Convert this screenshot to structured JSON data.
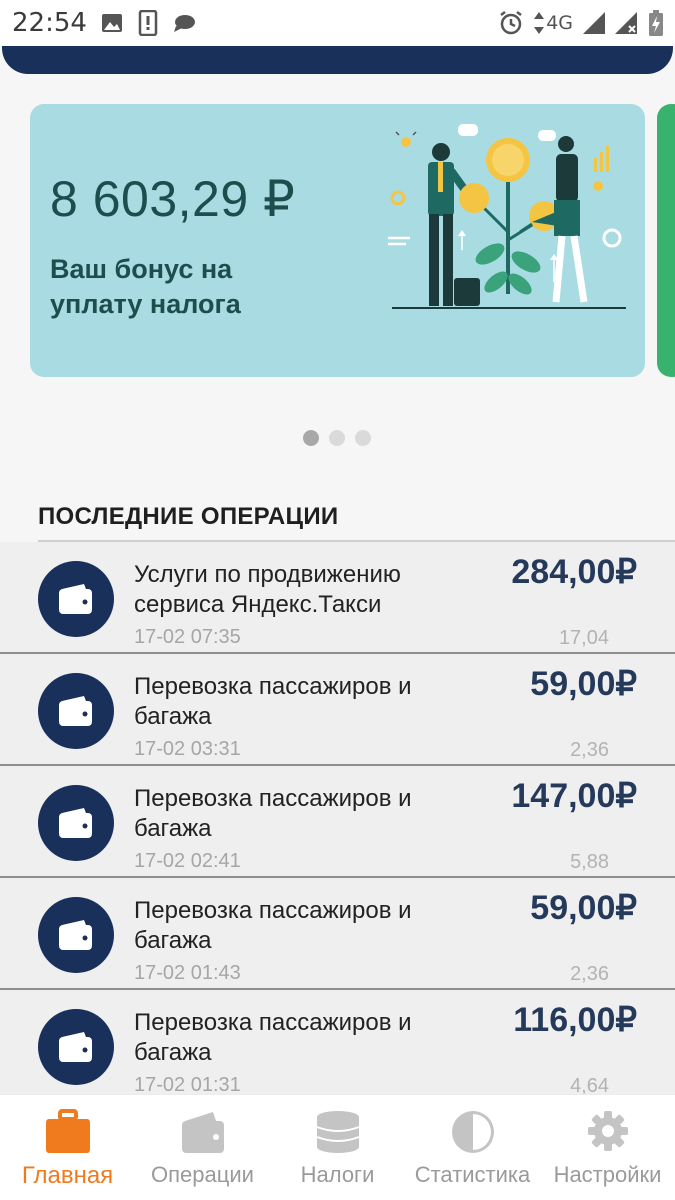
{
  "status_bar": {
    "time": "22:54",
    "network": "4G",
    "left_icons": [
      "image-icon",
      "notification-icon",
      "chat-icon"
    ],
    "right_icons": [
      "alarm-icon",
      "data-arrows-icon",
      "signal-icon",
      "signal-no-data-icon",
      "battery-charging-icon"
    ]
  },
  "banner": {
    "amount": "8 603,29 ₽",
    "caption": "Ваш бонус на уплату налога",
    "illustration": "business-growth-illustration",
    "background": "#a9dbe3",
    "text_color": "#1e4d4e"
  },
  "carousel": {
    "count": 3,
    "active_index": 0
  },
  "operations_section": {
    "title": "ПОСЛЕДНИЕ ОПЕРАЦИИ",
    "items": [
      {
        "title": "Услуги по продвижению сервиса Яндекс.Такси",
        "date": "17-02 07:35",
        "amount": "284,00₽",
        "tax": "17,04",
        "icon": "wallet-icon"
      },
      {
        "title": "Перевозка пассажиров и багажа",
        "date": "17-02 03:31",
        "amount": "59,00₽",
        "tax": "2,36",
        "icon": "wallet-icon"
      },
      {
        "title": "Перевозка пассажиров и багажа",
        "date": "17-02 02:41",
        "amount": "147,00₽",
        "tax": "5,88",
        "icon": "wallet-icon"
      },
      {
        "title": "Перевозка пассажиров и багажа",
        "date": "17-02 01:43",
        "amount": "59,00₽",
        "tax": "2,36",
        "icon": "wallet-icon"
      },
      {
        "title": "Перевозка пассажиров и багажа",
        "date": "17-02 01:31",
        "amount": "116,00₽",
        "tax": "4,64",
        "icon": "wallet-icon"
      }
    ]
  },
  "bottom_nav": {
    "items": [
      {
        "label": "Главная",
        "icon": "briefcase-icon",
        "active": true
      },
      {
        "label": "Операции",
        "icon": "wallet-icon",
        "active": false
      },
      {
        "label": "Налоги",
        "icon": "coins-stack-icon",
        "active": false
      },
      {
        "label": "Статистика",
        "icon": "pie-chart-icon",
        "active": false
      },
      {
        "label": "Настройки",
        "icon": "gear-icon",
        "active": false
      }
    ]
  },
  "colors": {
    "navy": "#18305a",
    "accent_orange": "#f07a1e",
    "next_card_green": "#38b36d"
  }
}
